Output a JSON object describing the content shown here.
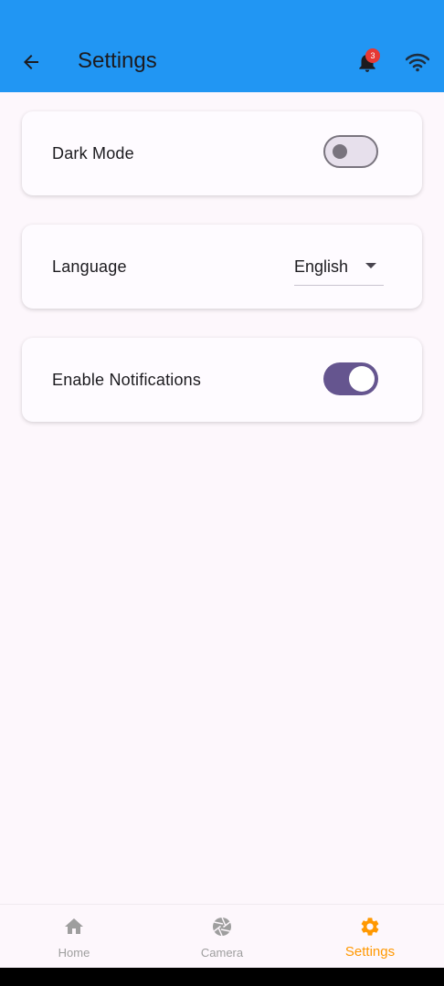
{
  "app_bar": {
    "title": "Settings",
    "notification_count": "3",
    "color": "#2196f3",
    "icons": [
      "arrow-back-icon",
      "bell-icon",
      "wifi-icon"
    ]
  },
  "settings": {
    "dark_mode": {
      "label": "Dark Mode",
      "enabled": false
    },
    "language": {
      "label": "Language",
      "value": "English"
    },
    "notifications": {
      "label": "Enable Notifications",
      "enabled": true
    }
  },
  "bottom_nav": {
    "items": [
      {
        "label": "Home",
        "icon": "home-icon",
        "active": false
      },
      {
        "label": "Camera",
        "icon": "camera-aperture-icon",
        "active": false
      },
      {
        "label": "Settings",
        "icon": "gear-icon",
        "active": true
      }
    ],
    "active_color": "#ff9800",
    "inactive_color": "#9e9e9e"
  },
  "colors": {
    "background": "#fdf7fc",
    "switch_on": "#65558f",
    "switch_off_track": "#e7e0ec",
    "switch_off_outline": "#79747e",
    "badge": "#e53935"
  }
}
